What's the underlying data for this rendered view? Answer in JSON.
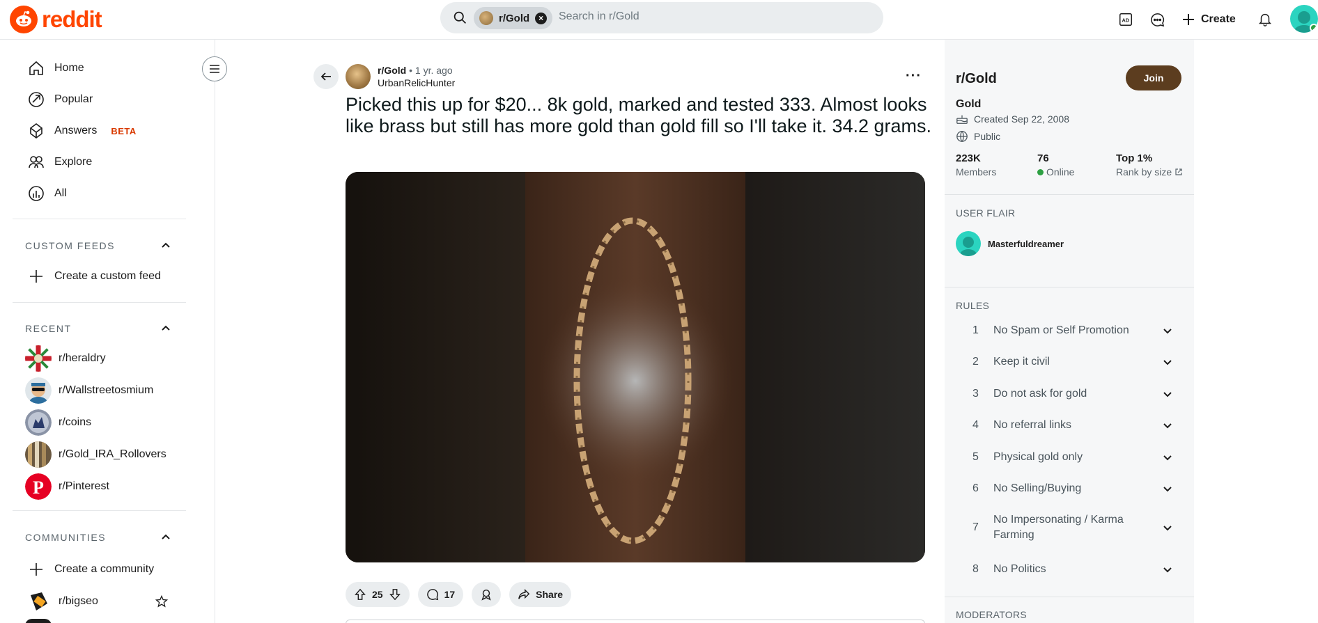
{
  "header": {
    "logo_text": "reddit",
    "search": {
      "chip_label": "r/Gold",
      "placeholder": "Search in r/Gold"
    },
    "create_label": "Create"
  },
  "sidebar": {
    "nav": [
      {
        "label": "Home",
        "icon": "home-icon"
      },
      {
        "label": "Popular",
        "icon": "popular-icon"
      },
      {
        "label": "Answers",
        "icon": "answers-icon",
        "badge": "BETA"
      },
      {
        "label": "Explore",
        "icon": "explore-icon"
      },
      {
        "label": "All",
        "icon": "all-icon"
      }
    ],
    "custom_feeds": {
      "heading": "CUSTOM FEEDS",
      "create_label": "Create a custom feed"
    },
    "recent": {
      "heading": "RECENT",
      "items": [
        "r/heraldry",
        "r/Wallstreetosmium",
        "r/coins",
        "r/Gold_IRA_Rollovers",
        "r/Pinterest"
      ]
    },
    "communities": {
      "heading": "COMMUNITIES",
      "create_label": "Create a community",
      "items": [
        "r/bigseo"
      ]
    }
  },
  "post": {
    "subreddit": "r/Gold",
    "separator": "•",
    "time": "1 yr. ago",
    "author": "UrbanRelicHunter",
    "title": "Picked this up for $20... 8k gold, marked and tested 333. Almost looks like brass but still has more gold than gold fill so I'll take it. 34.2 grams.",
    "votes": "25",
    "comments": "17",
    "share_label": "Share"
  },
  "community": {
    "name": "r/Gold",
    "join_label": "Join",
    "display_name": "Gold",
    "created": "Created Sep 22, 2008",
    "visibility": "Public",
    "stats": [
      {
        "value": "223K",
        "label": "Members"
      },
      {
        "value": "76",
        "label": "Online"
      },
      {
        "value": "Top 1%",
        "label": "Rank by size"
      }
    ],
    "user_flair_heading": "USER FLAIR",
    "flair_user": "Masterfuldreamer",
    "rules_heading": "RULES",
    "rules": [
      {
        "n": "1",
        "text": "No Spam or Self Promotion"
      },
      {
        "n": "2",
        "text": "Keep it civil"
      },
      {
        "n": "3",
        "text": "Do not ask for gold"
      },
      {
        "n": "4",
        "text": "No referral links"
      },
      {
        "n": "5",
        "text": "Physical gold only"
      },
      {
        "n": "6",
        "text": "No Selling/Buying"
      },
      {
        "n": "7",
        "text": "No Impersonating / Karma Farming"
      },
      {
        "n": "8",
        "text": "No Politics"
      }
    ],
    "moderators_heading": "MODERATORS"
  },
  "colors": {
    "brand": "#ff4500",
    "join": "#5c3d1f",
    "online": "#2ea043",
    "beta": "#d93a00"
  }
}
